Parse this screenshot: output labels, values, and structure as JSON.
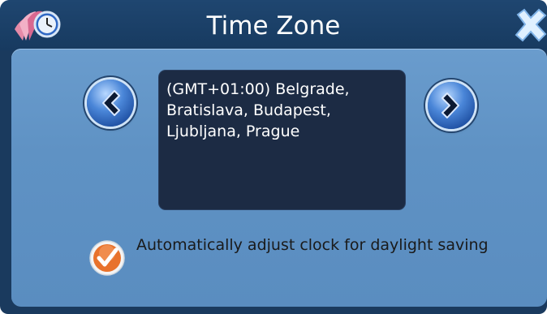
{
  "window": {
    "title": "Time Zone",
    "app_icon": "clock-icon",
    "close_icon": "close-icon"
  },
  "timezone": {
    "selected": "(GMT+01:00) Belgrade, Bratislava, Budapest, Ljubljana, Prague",
    "prev_icon": "chevron-left-icon",
    "next_icon": "chevron-right-icon"
  },
  "daylight": {
    "checked": true,
    "label": "Automatically adjust clock for daylight saving",
    "check_icon": "checkmark-icon"
  },
  "colors": {
    "title_bar": "#173a60",
    "panel": "#5f92c4",
    "zone_box": "#1c2b44",
    "accent_orange": "#e8722c"
  }
}
